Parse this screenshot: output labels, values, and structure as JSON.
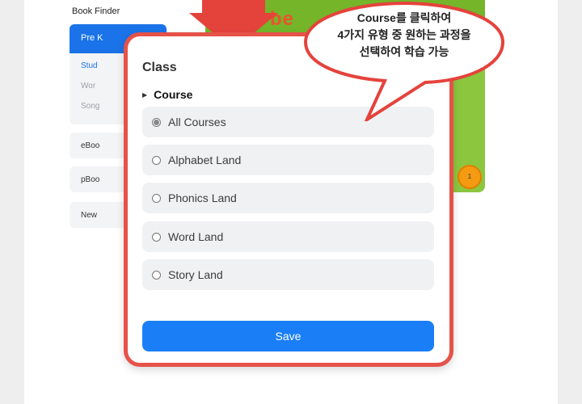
{
  "background": {
    "book_finder": "Book Finder",
    "active_tab": "Pre K",
    "sub_items": [
      "Stud",
      "Wor",
      "Song"
    ],
    "side_buttons": [
      "eBoo",
      "pBoo",
      "New"
    ],
    "cover_word": "be",
    "badge_count": "1"
  },
  "modal": {
    "title": "Class",
    "section_label": "Course",
    "options": [
      {
        "label": "All Courses",
        "selected": true
      },
      {
        "label": "Alphabet Land",
        "selected": false
      },
      {
        "label": "Phonics Land",
        "selected": false
      },
      {
        "label": "Word Land",
        "selected": false
      },
      {
        "label": "Story Land",
        "selected": false
      }
    ],
    "save_label": "Save"
  },
  "callout": {
    "line1": "Course를 클릭하여",
    "line2": "4가지 유형 중 원하는 과정을",
    "line3": "선택하여 학습 가능"
  },
  "colors": {
    "accent_red": "#e65248",
    "save_blue": "#1a7ff7",
    "tab_blue": "#1a73e8"
  }
}
